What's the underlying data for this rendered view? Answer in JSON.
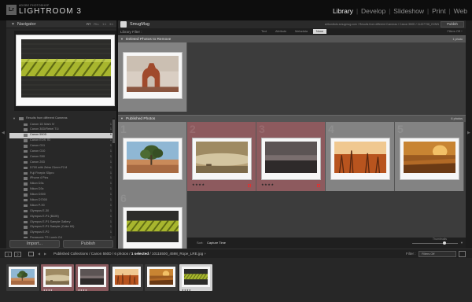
{
  "app": {
    "brand_small": "ADOBE PHOTOSHOP",
    "brand_name": "LIGHTROOM 3",
    "logo_text": "Lr"
  },
  "modules": [
    "Library",
    "Develop",
    "Slideshow",
    "Print",
    "Web"
  ],
  "active_module": "Library",
  "navigator": {
    "title": "Navigator",
    "zoom_options": [
      "FIT",
      "FILL",
      "1:1",
      "3:1"
    ]
  },
  "collections": {
    "header": "Results from different Cameras",
    "items": [
      {
        "name": "Canon 1D Mark IV",
        "count": "1"
      },
      {
        "name": "Canon 30D/Rebel T1i",
        "count": "1"
      },
      {
        "name": "Canon 550D",
        "count": "6",
        "selected": true
      },
      {
        "name": "Canon EOS 7D",
        "count": "1"
      },
      {
        "name": "Canon G11",
        "count": "1"
      },
      {
        "name": "Canon G10",
        "count": "1"
      },
      {
        "name": "Canon S90",
        "count": "1"
      },
      {
        "name": "Canon 20D",
        "count": "1"
      },
      {
        "name": "D700 with Zeiss 21mm F2.8",
        "count": "1"
      },
      {
        "name": "Fuji Finepix S5pro",
        "count": "1"
      },
      {
        "name": "iPhone 4 Pics",
        "count": "1"
      },
      {
        "name": "Nikon D3s",
        "count": "1"
      },
      {
        "name": "Nikon D3x",
        "count": "1"
      },
      {
        "name": "Nikon D300",
        "count": "1"
      },
      {
        "name": "Nikon D7000",
        "count": "1"
      },
      {
        "name": "Nikon P-90",
        "count": "1"
      },
      {
        "name": "Olympus E-30",
        "count": "1"
      },
      {
        "name": "Olympus E-P1 (B&W)",
        "count": "1"
      },
      {
        "name": "Olympus E-P1 Sample Gallery",
        "count": "1"
      },
      {
        "name": "Olympus E-P1 Sample (Color 60)",
        "count": "1"
      },
      {
        "name": "Olympus E-P2",
        "count": "1"
      },
      {
        "name": "Panasonic TS Lumix G4",
        "count": "1"
      },
      {
        "name": "Panasonic GH1 on G1",
        "count": "1"
      },
      {
        "name": "Panasonic GH2 with Olympus 17mm",
        "count": "1"
      },
      {
        "name": "Panasonic Lumix G1",
        "count": "1"
      }
    ]
  },
  "left_buttons": {
    "import": "Import...",
    "publish": "Publish"
  },
  "main_header": {
    "service": "SmugMug",
    "url": "zeitundtoto.smugmug.com / Results from different Cameras / Canon 550D / 11437738_GXNN",
    "publish_button": "Publish"
  },
  "filter_bar": {
    "label": "Library Filter :",
    "tabs": [
      "Text",
      "Attribute",
      "Metadata",
      "None"
    ],
    "active_tab": "None",
    "filters_off": "Filters Off ÷"
  },
  "sections": {
    "deleted": {
      "title": "Deleted Photos to Remove",
      "count": "1 photo"
    },
    "published": {
      "title": "Published Photos",
      "count": "6 photos"
    }
  },
  "grid_cells": {
    "deleted": [
      {
        "photo": "arch",
        "index": "",
        "stars": ""
      }
    ],
    "published": [
      {
        "photo": "tree",
        "index": "1",
        "stars": "",
        "pink": false
      },
      {
        "photo": "fog",
        "index": "2",
        "stars": "★★★★",
        "pink": true
      },
      {
        "photo": "dark",
        "index": "3",
        "stars": "★★★★",
        "pink": true
      },
      {
        "photo": "fire",
        "index": "4",
        "stars": "",
        "pink": false
      },
      {
        "photo": "sunset",
        "index": "5",
        "stars": "",
        "pink": false
      },
      {
        "photo": "rope",
        "index": "6",
        "stars": "",
        "pink": false
      }
    ]
  },
  "toolbar": {
    "sort_label": "Sort:",
    "sort_value": "Capture Time",
    "thumbnails_label": "Thumbnails",
    "thumbnail_size": 0.72
  },
  "filmstrip_bar": {
    "num1": "1",
    "num2": "2",
    "path_prefix": "Published Collections / Canon 550D / 6 photos /",
    "selected_text": "1 selected",
    "path_suffix": "/ 10115500_4598_Rope_LRE.jpg ÷",
    "filter_label": "Filter :",
    "filter_value": "Filters Off"
  },
  "filmstrip": [
    {
      "photo": "tree",
      "stars": "",
      "style": "normal"
    },
    {
      "photo": "fog",
      "stars": "★★★★",
      "style": "pink"
    },
    {
      "photo": "dark",
      "stars": "★★★★",
      "style": "pink"
    },
    {
      "photo": "fire",
      "stars": "",
      "style": "normal"
    },
    {
      "photo": "sunset",
      "stars": "",
      "style": "normal"
    },
    {
      "photo": "rope",
      "stars": "★★★★",
      "style": "selected"
    }
  ],
  "colors": {
    "accent_pink": "#8d5a5e",
    "selected_row": "#cfcfcf",
    "grid_gray": "#838383"
  }
}
